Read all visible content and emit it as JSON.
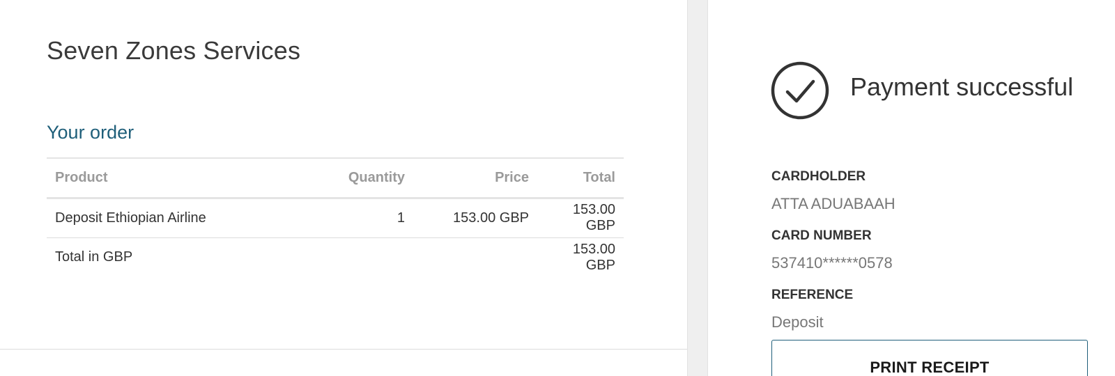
{
  "merchant": {
    "name": "Seven Zones Services"
  },
  "order": {
    "heading": "Your order",
    "columns": {
      "product": "Product",
      "quantity": "Quantity",
      "price": "Price",
      "total": "Total"
    },
    "items": [
      {
        "product": "Deposit Ethiopian Airline",
        "quantity": "1",
        "price": "153.00 GBP",
        "total": "153.00 GBP"
      }
    ],
    "summary": {
      "label": "Total in GBP",
      "total": "153.00 GBP"
    }
  },
  "payment": {
    "status": "Payment successful",
    "status_icon": "check-circle-icon",
    "cardholder_label": "CARDHOLDER",
    "cardholder": "ATTA ADUABAAH",
    "card_number_label": "CARD NUMBER",
    "card_number": "537410******0578",
    "reference_label": "REFERENCE",
    "reference": "Deposit",
    "print_label": "PRINT RECEIPT"
  },
  "colors": {
    "accent": "#1f5f7a",
    "text": "#333333",
    "muted": "#9a9a9a",
    "divider": "#efefef"
  }
}
